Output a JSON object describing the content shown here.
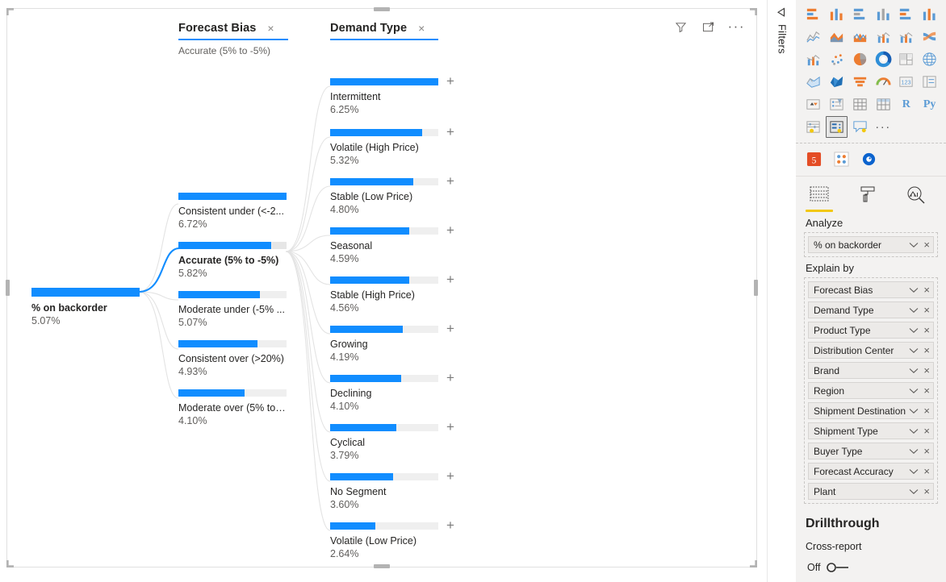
{
  "visual": {
    "tools": [
      {
        "name": "filter-icon",
        "title": "Filters"
      },
      {
        "name": "focus-mode-icon",
        "title": "Focus mode"
      },
      {
        "name": "more-options-icon",
        "title": "More options",
        "glyph": "···"
      }
    ]
  },
  "tree": {
    "root": {
      "label": "% on backorder",
      "value": "5.07%",
      "fill_pct": 100
    },
    "columns": [
      {
        "title": "Forecast Bias",
        "subtitle": "Accurate (5% to -5%)",
        "close_glyph": "×",
        "nodes": [
          {
            "label": "Consistent under (<-2...",
            "value": "6.72%",
            "fill_pct": 100,
            "selected": false,
            "handle": false
          },
          {
            "label": "Accurate (5% to -5%)",
            "value": "5.82%",
            "fill_pct": 86,
            "selected": true,
            "handle": true
          },
          {
            "label": "Moderate under (-5% ...",
            "value": "5.07%",
            "fill_pct": 75,
            "selected": false,
            "handle": false
          },
          {
            "label": "Consistent over (>20%)",
            "value": "4.93%",
            "fill_pct": 73,
            "selected": false,
            "handle": false
          },
          {
            "label": "Moderate over (5% to ...",
            "value": "4.10%",
            "fill_pct": 61,
            "selected": false,
            "handle": false
          }
        ]
      },
      {
        "title": "Demand Type",
        "subtitle": "",
        "close_glyph": "×",
        "nodes": [
          {
            "label": "Intermittent",
            "value": "6.25%",
            "fill_pct": 100,
            "expand_glyph": "+"
          },
          {
            "label": "Volatile (High Price)",
            "value": "5.32%",
            "fill_pct": 85,
            "expand_glyph": "+"
          },
          {
            "label": "Stable (Low Price)",
            "value": "4.80%",
            "fill_pct": 77,
            "expand_glyph": "+"
          },
          {
            "label": "Seasonal",
            "value": "4.59%",
            "fill_pct": 73,
            "expand_glyph": "+"
          },
          {
            "label": "Stable (High Price)",
            "value": "4.56%",
            "fill_pct": 73,
            "expand_glyph": "+"
          },
          {
            "label": "Growing",
            "value": "4.19%",
            "fill_pct": 67,
            "expand_glyph": "+"
          },
          {
            "label": "Declining",
            "value": "4.10%",
            "fill_pct": 66,
            "expand_glyph": "+"
          },
          {
            "label": "Cyclical",
            "value": "3.79%",
            "fill_pct": 61,
            "expand_glyph": "+"
          },
          {
            "label": "No Segment",
            "value": "3.60%",
            "fill_pct": 58,
            "expand_glyph": "+"
          },
          {
            "label": "Volatile (Low Price)",
            "value": "2.64%",
            "fill_pct": 42,
            "expand_glyph": "+"
          }
        ]
      }
    ]
  },
  "chart_data": {
    "type": "bar",
    "title": "Decomposition tree: % on backorder",
    "ylabel": "% on backorder",
    "root": {
      "category": "% on backorder",
      "value": 5.07
    },
    "levels": [
      {
        "field": "Forecast Bias",
        "selected": "Accurate (5% to -5%)",
        "categories": [
          "Consistent under (<-2...",
          "Accurate (5% to -5%)",
          "Moderate under (-5% ...",
          "Consistent over (>20%)",
          "Moderate over (5% to ..."
        ],
        "values": [
          6.72,
          5.82,
          5.07,
          4.93,
          4.1
        ]
      },
      {
        "field": "Demand Type",
        "selected": "",
        "categories": [
          "Intermittent",
          "Volatile (High Price)",
          "Stable (Low Price)",
          "Seasonal",
          "Stable (High Price)",
          "Growing",
          "Declining",
          "Cyclical",
          "No Segment",
          "Volatile (Low Price)"
        ],
        "values": [
          6.25,
          5.32,
          4.8,
          4.59,
          4.56,
          4.19,
          4.1,
          3.79,
          3.6,
          2.64
        ]
      }
    ],
    "unit": "%",
    "grid": false,
    "legend": "none"
  },
  "filters_pane": {
    "label": "Filters",
    "arrow_name": "collapse-arrow-icon"
  },
  "viz_gallery": {
    "icons": [
      "stacked-bar-chart-icon",
      "stacked-column-chart-icon",
      "clustered-bar-chart-icon",
      "clustered-column-chart-icon",
      "100-stacked-bar-chart-icon",
      "100-stacked-column-chart-icon",
      "line-chart-icon",
      "area-chart-icon",
      "stacked-area-chart-icon",
      "line-stacked-column-icon",
      "line-clustered-column-icon",
      "ribbon-chart-icon",
      "waterfall-chart-icon",
      "scatter-chart-icon",
      "pie-chart-icon",
      "donut-chart-icon",
      "treemap-icon",
      "map-icon",
      "filled-map-icon",
      "shape-map-icon",
      "funnel-icon",
      "gauge-icon",
      "card-icon",
      "multi-row-card-icon",
      "kpi-icon",
      "slicer-icon",
      "table-icon",
      "matrix-icon",
      "r-script-visual-icon",
      "python-visual-icon",
      "key-influencers-icon",
      "decomposition-tree-icon",
      "qa-visual-icon",
      "more-visuals-icon"
    ],
    "selected_index": 31,
    "r_label": "R",
    "py_label": "Py",
    "more_glyph": "···"
  },
  "format_bar": {
    "icons": [
      "html-visual-icon",
      "smart-narrative-icon",
      "paginated-report-icon"
    ]
  },
  "pane": {
    "tabs": [
      {
        "name": "fields-tab",
        "icon": "fields-icon",
        "active": true
      },
      {
        "name": "format-tab",
        "icon": "paint-roller-icon",
        "active": false
      },
      {
        "name": "analytics-tab",
        "icon": "analytics-magnifier-icon",
        "active": false
      }
    ],
    "analyze_label": "Analyze",
    "analyze_field": {
      "name": "% on backorder",
      "caret": "chevron-down-icon",
      "remove": "×"
    },
    "explain_by_label": "Explain by",
    "explain_by_fields": [
      "Forecast Bias",
      "Demand Type",
      "Product Type",
      "Distribution Center",
      "Brand",
      "Region",
      "Shipment Destination",
      "Shipment Type",
      "Buyer Type",
      "Forecast Accuracy",
      "Plant"
    ],
    "drillthrough_title": "Drillthrough",
    "cross_report_label": "Cross-report",
    "cross_report_state": "Off",
    "chip_remove_glyph": "×"
  },
  "colors": {
    "bar_fill": "#118dff",
    "bar_track": "#efefef",
    "accent_underline": "#1a8cff",
    "tab_underline": "#f2c811",
    "pane_bg": "#f3f2f1"
  }
}
